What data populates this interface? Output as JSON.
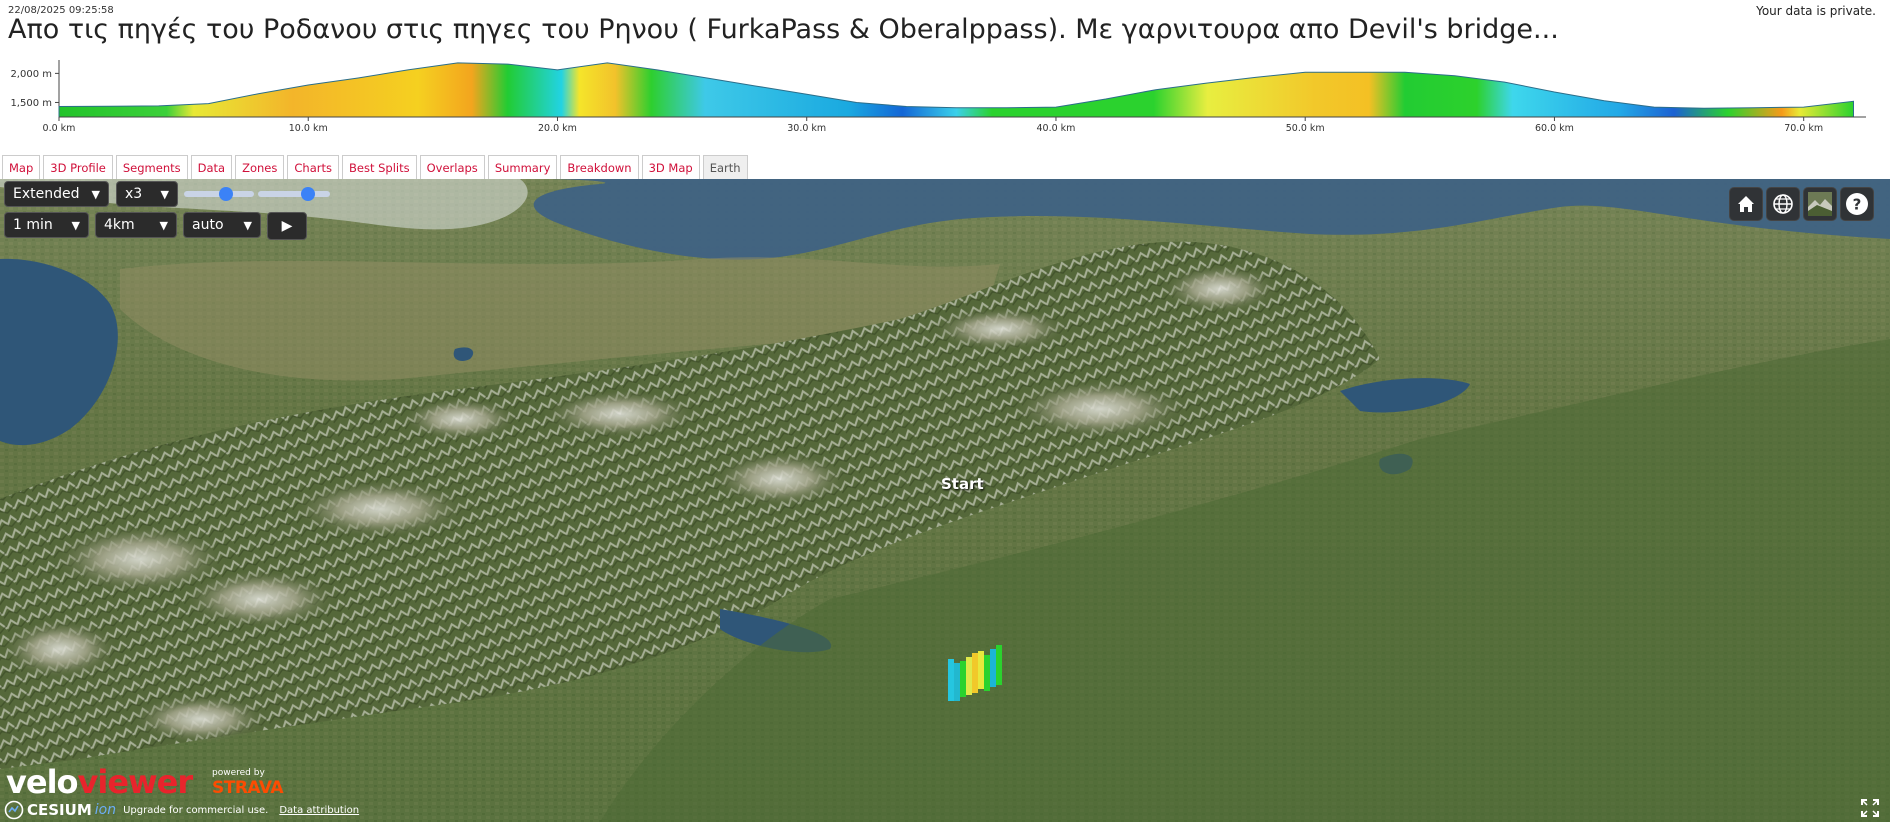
{
  "header": {
    "timestamp": "22/08/2025 09:25:58",
    "privacy": "Your data is private.",
    "title": "Απο τις πηγές του Ροδανου στις πηγες του Ρηνου ( FurkaPass & Oberalppass). Με γαρνιτουρα απο Devil's bridge..."
  },
  "elevation_profile": {
    "y_ticks": [
      "2,000 m",
      "1,500 m"
    ],
    "x_ticks": [
      "0.0 km",
      "10.0 km",
      "20.0 km",
      "30.0 km",
      "40.0 km",
      "50.0 km",
      "60.0 km",
      "70.0 km"
    ],
    "distance_km": [
      0,
      2,
      4,
      6,
      8,
      10,
      12,
      14,
      16,
      18,
      20,
      22,
      24,
      26,
      28,
      30,
      32,
      34,
      36,
      38,
      40,
      42,
      44,
      46,
      48,
      50,
      52,
      54,
      56,
      58,
      60,
      62,
      64,
      66,
      68,
      70,
      72
    ],
    "elevation_m": [
      1430,
      1435,
      1440,
      1480,
      1650,
      1800,
      1920,
      2060,
      2180,
      2160,
      2060,
      2180,
      2060,
      1920,
      1780,
      1640,
      1500,
      1430,
      1410,
      1410,
      1420,
      1560,
      1720,
      1830,
      1930,
      2020,
      2020,
      2020,
      1960,
      1850,
      1680,
      1530,
      1420,
      1400,
      1410,
      1420,
      1520
    ]
  },
  "tabs": [
    {
      "label": "Map",
      "active": false
    },
    {
      "label": "3D Profile",
      "active": false
    },
    {
      "label": "Segments",
      "active": false
    },
    {
      "label": "Data",
      "active": false
    },
    {
      "label": "Zones",
      "active": false
    },
    {
      "label": "Charts",
      "active": false
    },
    {
      "label": "Best Splits",
      "active": false
    },
    {
      "label": "Overlaps",
      "active": false
    },
    {
      "label": "Summary",
      "active": false
    },
    {
      "label": "Breakdown",
      "active": false
    },
    {
      "label": "3D Map",
      "active": false
    },
    {
      "label": "Earth",
      "active": true
    }
  ],
  "controls": {
    "mode": "Extended",
    "exaggeration": "x3",
    "interval": "1 min",
    "distance": "4km",
    "speed": "auto",
    "play_symbol": "▶",
    "slider1_level": 0.6,
    "slider2_level": 0.7
  },
  "right_buttons": [
    "home-icon",
    "globe-icon",
    "layers-icon",
    "help-icon"
  ],
  "map_label": "Start",
  "branding": {
    "velo": "velo",
    "viewer": "viewer",
    "powered_by": "powered by",
    "strava": "STRAVA",
    "cesium": "CESIUM",
    "ion": "ion",
    "upgrade": "Upgrade for commercial use.",
    "attribution": "Data attribution"
  },
  "colors": {
    "tab_text": "#d0103a",
    "strava": "#fc4c02",
    "button_bg": "#2b2b2b",
    "slider_knob": "#3b82f6"
  }
}
